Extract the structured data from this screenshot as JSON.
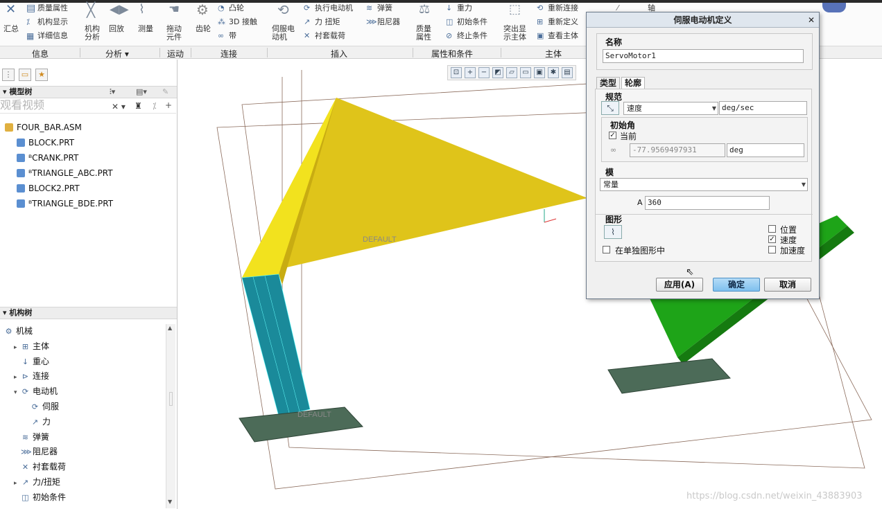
{
  "ribbon": {
    "summary_label": "汇总",
    "mass_properties": "质量属性",
    "mechanism_display": "机构显示",
    "detail_info": "详细信息",
    "mechanism_analysis": "机构\n分析",
    "playback": "回放",
    "measure": "测量",
    "drag_components": "拖动\n元件",
    "gear": "齿轮",
    "cam": "凸轮",
    "contact_3d": "3D 接触",
    "belt": "带",
    "servo_motor": "伺服电\n动机",
    "execute_motor": "执行电动机",
    "force_torque": "力 扭矩",
    "bushing_load": "衬套载荷",
    "spring": "弹簧",
    "damper": "阻尼器",
    "mass_props2": "质量\n属性",
    "gravity": "重力",
    "initial_condition": "初始条件",
    "termination_condition": "终止条件",
    "highlight_body": "突出显\n示主体",
    "reconnect": "重新连接",
    "redefine": "重新定义",
    "view_body": "查看主体",
    "axis": "轴",
    "groups": [
      "信息",
      "分析 ▾",
      "运动",
      "连接",
      "插入",
      "属性和条件",
      "主体"
    ]
  },
  "left_panel": {
    "model_tree_label": "模型树",
    "overlay_text": "观看视频",
    "model_items": [
      {
        "name": "FOUR_BAR.ASM",
        "type": "asm"
      },
      {
        "name": "BLOCK.PRT",
        "type": "part"
      },
      {
        "name": "ᴮCRANK.PRT",
        "type": "part"
      },
      {
        "name": "ᴮTRIANGLE_ABC.PRT",
        "type": "part"
      },
      {
        "name": "BLOCK2.PRT",
        "type": "part"
      },
      {
        "name": "ᴮTRIANGLE_BDE.PRT",
        "type": "part"
      }
    ],
    "mech_tree_label": "机构树",
    "mech_items": [
      {
        "name": "机械",
        "indent": 0,
        "arrow": ""
      },
      {
        "name": "主体",
        "indent": 1,
        "arrow": "▸"
      },
      {
        "name": "重心",
        "indent": 1,
        "arrow": ""
      },
      {
        "name": "连接",
        "indent": 1,
        "arrow": "▸"
      },
      {
        "name": "电动机",
        "indent": 1,
        "arrow": "▾"
      },
      {
        "name": "伺服",
        "indent": 2,
        "arrow": ""
      },
      {
        "name": "力",
        "indent": 2,
        "arrow": ""
      },
      {
        "name": "弹簧",
        "indent": 1,
        "arrow": ""
      },
      {
        "name": "阻尼器",
        "indent": 1,
        "arrow": ""
      },
      {
        "name": "衬套载荷",
        "indent": 1,
        "arrow": ""
      },
      {
        "name": "力/扭矩",
        "indent": 1,
        "arrow": "▸"
      },
      {
        "name": "初始条件",
        "indent": 1,
        "arrow": ""
      }
    ]
  },
  "viewport": {
    "default_label_1": "DEFAULT",
    "default_label_2": "DEFAULT"
  },
  "dialog": {
    "title": "伺服电动机定义",
    "name_label": "名称",
    "name_value": "ServoMotor1",
    "tab_type": "类型",
    "tab_profile": "轮廓",
    "spec_label": "规范",
    "spec_value": "速度",
    "spec_unit": "deg/sec",
    "initial_angle_label": "初始角",
    "current_label": "当前",
    "current_checked": true,
    "angle_value": "-77.9569497931",
    "angle_unit": "deg",
    "model_label": "模",
    "model_value": "常量",
    "a_label": "A",
    "a_value": "360",
    "graph_label": "图形",
    "position_label": "位置",
    "velocity_label": "速度",
    "acceleration_label": "加速度",
    "separate_graph_label": "在单独图形中",
    "position_checked": false,
    "velocity_checked": true,
    "acceleration_checked": false,
    "separate_graph_checked": false,
    "apply_button": "应用(A)",
    "ok_button": "确定",
    "cancel_button": "取消"
  },
  "watermark": "https://blog.csdn.net/weixin_43883903"
}
